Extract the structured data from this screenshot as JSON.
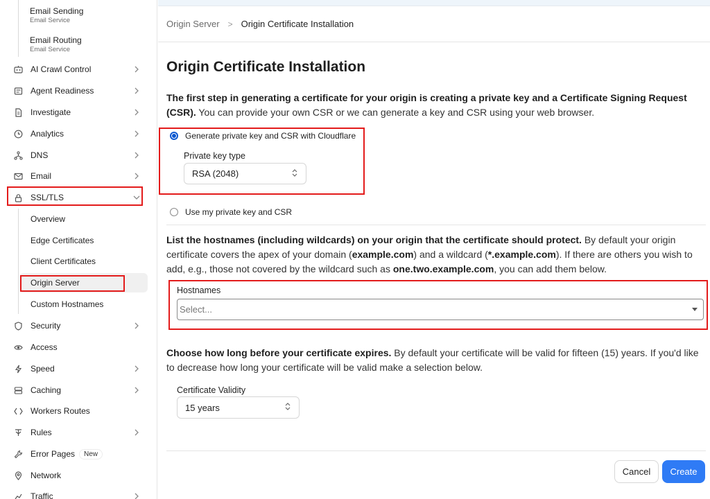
{
  "sidebar": {
    "email_sub": [
      {
        "title": "Email Sending",
        "subtitle": "Email Service"
      },
      {
        "title": "Email Routing",
        "subtitle": "Email Service"
      }
    ],
    "items": [
      {
        "label": "AI Crawl Control",
        "icon": "crawl-icon"
      },
      {
        "label": "Agent Readiness",
        "icon": "agent-icon"
      },
      {
        "label": "Investigate",
        "icon": "document-icon"
      },
      {
        "label": "Analytics",
        "icon": "clock-icon"
      },
      {
        "label": "DNS",
        "icon": "network-icon"
      },
      {
        "label": "Email",
        "icon": "mail-icon"
      },
      {
        "label": "SSL/TLS",
        "icon": "lock-icon"
      }
    ],
    "ssl_sub": [
      {
        "label": "Overview"
      },
      {
        "label": "Edge Certificates"
      },
      {
        "label": "Client Certificates"
      },
      {
        "label": "Origin Server"
      },
      {
        "label": "Custom Hostnames"
      }
    ],
    "items_after": [
      {
        "label": "Security",
        "icon": "shield-icon"
      },
      {
        "label": "Access",
        "icon": "access-icon"
      },
      {
        "label": "Speed",
        "icon": "bolt-icon"
      },
      {
        "label": "Caching",
        "icon": "cache-icon"
      },
      {
        "label": "Workers Routes",
        "icon": "workers-icon"
      },
      {
        "label": "Rules",
        "icon": "rules-icon"
      },
      {
        "label": "Error Pages",
        "icon": "wrench-icon",
        "badge": "New"
      },
      {
        "label": "Network",
        "icon": "pin-icon"
      },
      {
        "label": "Traffic",
        "icon": "traffic-icon"
      }
    ]
  },
  "breadcrumb": {
    "parent": "Origin Server",
    "separator": ">",
    "current": "Origin Certificate Installation"
  },
  "page": {
    "title": "Origin Certificate Installation",
    "intro_bold": "The first step in generating a certificate for your origin is creating a private key and a Certificate Signing Request (CSR).",
    "intro_rest": " You can provide your own CSR or we can generate a key and CSR using your web browser.",
    "radio_generate": "Generate private key and CSR with Cloudflare",
    "key_type_label": "Private key type",
    "key_type_value": "RSA (2048)",
    "radio_own": "Use my private key and CSR",
    "hosts_bold": "List the hostnames (including wildcards) on your origin that the certificate should protect.",
    "hosts_t1": " By default your origin certificate covers the apex of your domain (",
    "hosts_b1": "example.com",
    "hosts_t2": ") and a wildcard (",
    "hosts_b2": "*.example.com",
    "hosts_t3": "). If there are others you wish to add, e.g., those not covered by the wildcard such as ",
    "hosts_b3": "one.two.example.com",
    "hosts_t4": ", you can add them below.",
    "hostnames_label": "Hostnames",
    "hostnames_placeholder": "Select...",
    "validity_bold": "Choose how long before your certificate expires.",
    "validity_rest": " By default your certificate will be valid for fifteen (15) years. If you'd like to decrease how long your certificate will be valid make a selection below.",
    "validity_label": "Certificate Validity",
    "validity_value": "15 years",
    "cancel_label": "Cancel",
    "create_label": "Create"
  },
  "colors": {
    "primary": "#2f7bf5",
    "radio": "#0b57d0",
    "highlight": "#e31b1b"
  }
}
